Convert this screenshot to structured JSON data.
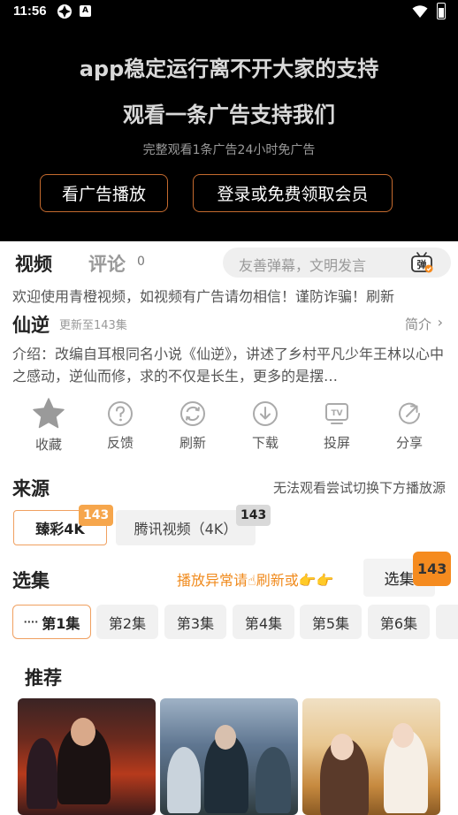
{
  "status_bar": {
    "time": "11:56",
    "notif_badge": "A"
  },
  "ad_banner": {
    "title_line1": "app稳定运行离不开大家的支持",
    "title_line2": "观看一条广告支持我们",
    "subtitle": "完整观看1条广告24小时免广告",
    "watch_ad_button": "看广告播放",
    "login_button": "登录或免费领取会员"
  },
  "tabs": {
    "video": "视频",
    "comment": "评论",
    "comment_count": "0"
  },
  "danmu": {
    "placeholder": "友善弹幕，文明发言",
    "icon_label": "弹"
  },
  "marquee": "欢迎使用青橙视频，如视频有广告请勿相信！谨防诈骗！刷新",
  "show": {
    "title": "仙逆",
    "update": "更新至143集",
    "intro_link": "简介",
    "description": "介绍：改编自耳根同名小说《仙逆》，讲述了乡村平凡少年王林以心中之感动，逆仙而修，求的不仅是长生，更多的是摆…"
  },
  "actions": [
    {
      "label": "收藏",
      "icon": "star-icon"
    },
    {
      "label": "反馈",
      "icon": "question-icon"
    },
    {
      "label": "刷新",
      "icon": "refresh-icon"
    },
    {
      "label": "下载",
      "icon": "download-icon"
    },
    {
      "label": "投屏",
      "icon": "tv-icon"
    },
    {
      "label": "分享",
      "icon": "share-icon"
    }
  ],
  "source": {
    "title": "来源",
    "hint": "无法观看尝试切换下方播放源",
    "items": [
      {
        "name": "臻彩4K",
        "count": "143",
        "selected": true
      },
      {
        "name": "腾讯视频（4K）",
        "count": "143",
        "selected": false
      }
    ]
  },
  "episodes": {
    "title": "选集",
    "hint": "播放异常请☝刷新或👉👉",
    "button": "选集",
    "count": "143",
    "items": [
      "第1集",
      "第2集",
      "第3集",
      "第4集",
      "第5集",
      "第6集"
    ],
    "playing_indicator": "····"
  },
  "recommend": {
    "title": "推荐"
  },
  "colors": {
    "accent": "#f58b1f",
    "accent_border": "#f0a060",
    "ad_button_border": "#c46a2e"
  }
}
